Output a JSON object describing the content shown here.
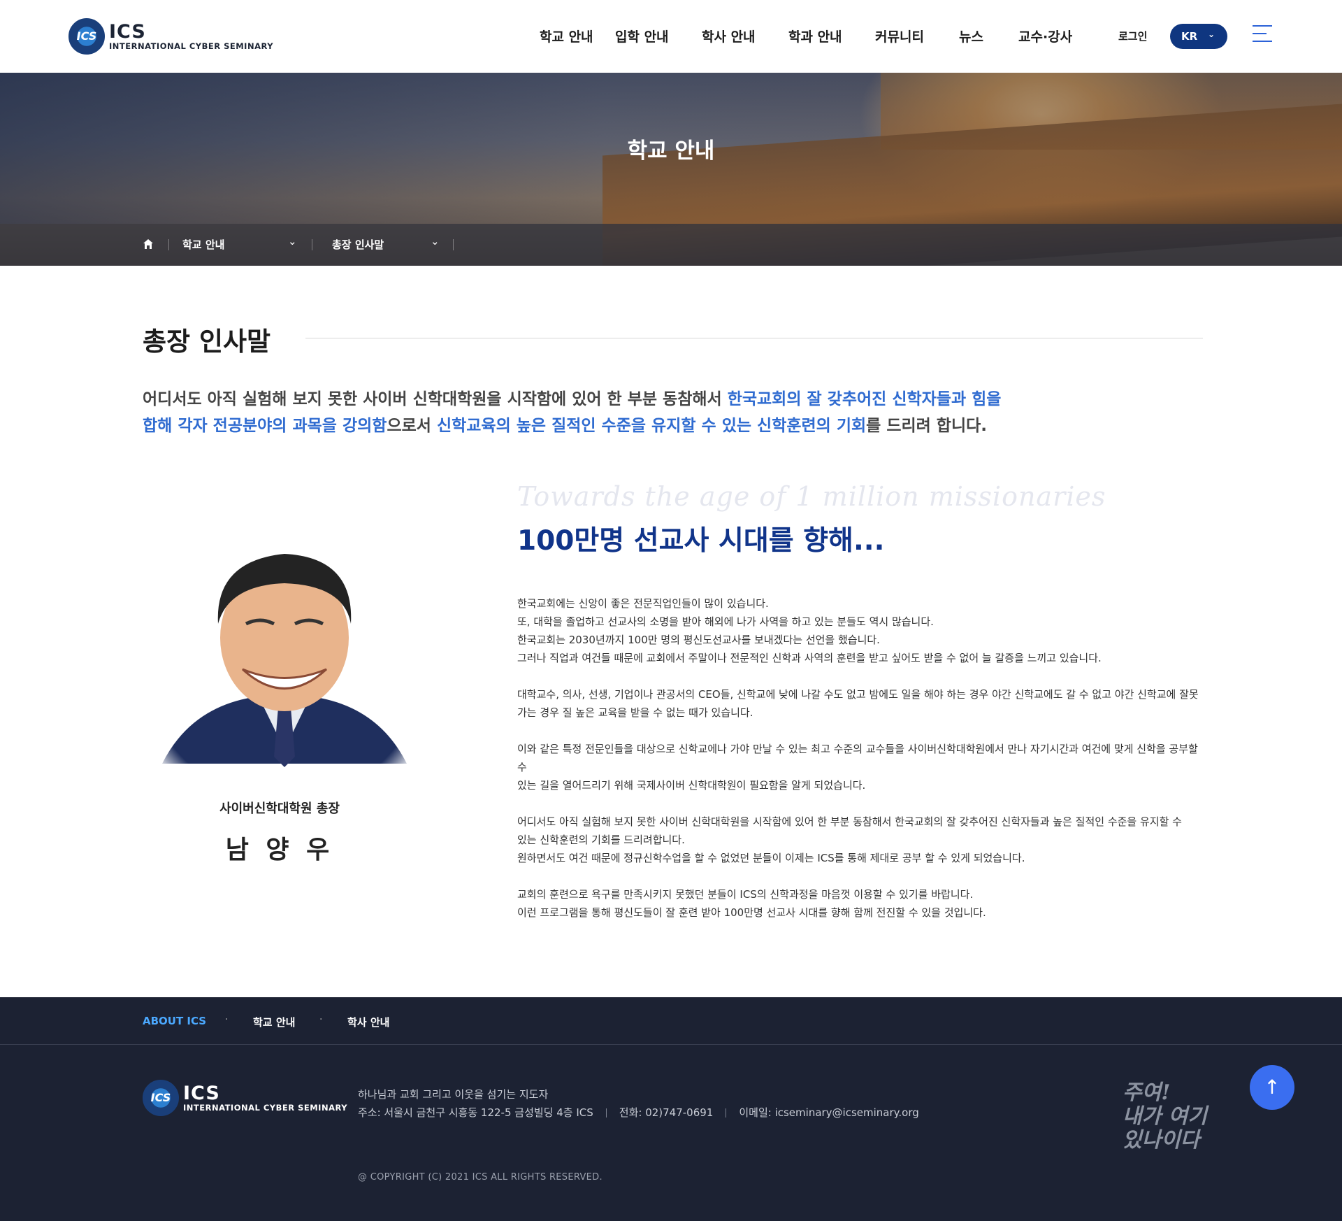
{
  "header": {
    "logo_big": "ICS",
    "logo_small": "INTERNATIONAL CYBER SEMINARY",
    "logo_emblem": "ICS",
    "nav": [
      "학교 안내",
      "입학 안내",
      "학사 안내",
      "학과 안내",
      "커뮤니티",
      "뉴스",
      "교수·강사"
    ],
    "login": "로그인",
    "lang": "KR"
  },
  "hero": {
    "title": "학교 안내",
    "breadcrumb": [
      "학교 안내",
      "총장 인사말"
    ]
  },
  "main": {
    "title": "총장 인사말",
    "intro": [
      {
        "text": "어디서도 아직 실험해 보지 못한 사이버 신학대학원을 시작함에 있어 한 부분 동참해서 ",
        "hl": false
      },
      {
        "text": "한국교회의 잘 갖추어진 신학자들과 힘을 합해 각자 전공분야의 과목을 강의함",
        "hl": true
      },
      {
        "text": "으로서 ",
        "hl": false
      },
      {
        "text": "신학교육의 높은 질적인 수준을 유지할 수 있는 신학훈련의 기회",
        "hl": true
      },
      {
        "text": "를 드리려 합니다.",
        "hl": false
      }
    ],
    "caption_role": "사이버신학대학원 총장",
    "caption_name": "남 양 우",
    "script_en": "Towards the age of 1 million missionaries",
    "headline": "100만명 선교사 시대를 향해...",
    "paragraphs": [
      [
        "한국교회에는 신앙이 좋은 전문직업인들이 많이 있습니다.",
        "또, 대학을 졸업하고 선교사의 소명을 받아 해외에 나가 사역을 하고 있는 분들도 역시 많습니다.",
        "한국교회는 2030년까지 100만 명의 평신도선교사를 보내겠다는 선언을 했습니다.",
        "그러나 직업과 여건들 때문에 교회에서 주말이나 전문적인 신학과 사역의 훈련을 받고 싶어도 받을 수 없어 늘 갈증을 느끼고 있습니다."
      ],
      [
        "대학교수, 의사, 선생, 기업이나 관공서의 CEO들, 신학교에 낮에 나갈 수도 없고 밤에도 일을 해야 하는 경우 야간 신학교에도 갈 수 없고 야간 신학교에 잘못",
        "가는 경우 질 높은 교육을 받을 수 없는 때가 있습니다."
      ],
      [
        "이와 같은 특정 전문인들을 대상으로 신학교에나 가야 만날 수 있는 최고 수준의 교수들을 사이버신학대학원에서 만나 자기시간과 여건에 맞게 신학을 공부할 수",
        "있는 길을 열어드리기 위해 국제사이버 신학대학원이 필요함을 알게 되었습니다."
      ],
      [
        "어디서도 아직 실험해 보지 못한 사이버 신학대학원을 시작함에 있어 한 부분 동참해서 한국교회의 잘 갖추어진 신학자들과 높은 질적인 수준을 유지할 수",
        "있는 신학훈련의 기회를 드리려합니다.",
        "원하면서도 여건 때문에 정규신학수업을 할 수 없었던 분들이 이제는 ICS를 통해 제대로 공부 할 수 있게 되었습니다."
      ],
      [
        "교회의 훈련으로 욕구를 만족시키지 못했던 분들이  ICS의 신학과정을 마음껏 이용할 수 있기를 바랍니다.",
        "이런 프로그램을 통해 평신도들이 잘 훈련 받아 100만명 선교사 시대를 향해 함께 전진할 수 있을 것입니다."
      ]
    ]
  },
  "footer": {
    "nav": [
      "ABOUT ICS",
      "학교 안내",
      "학사 안내"
    ],
    "tagline": "하나님과 교회 그리고 이웃을 섬기는 지도자",
    "address": "주소: 서울시 금천구 시흥동 122-5 금성빌딩 4층 ICS",
    "phone": "전화: 02)747-0691",
    "email": "이메일: icseminary@icseminary.org",
    "copyright": "@ COPYRIGHT (C) 2021 ICS ALL RIGHTS RESERVED.",
    "slogan": [
      "주여!",
      "내가 여기",
      "있나이다"
    ]
  },
  "colors": {
    "accent": "#2f6bd0",
    "navy": "#10348a",
    "footer_bg": "#1c2233",
    "top_button": "#3a6ef0"
  },
  "icons": {
    "home": "home-icon",
    "menu": "hamburger-menu-icon",
    "top": "arrow-up-icon"
  }
}
